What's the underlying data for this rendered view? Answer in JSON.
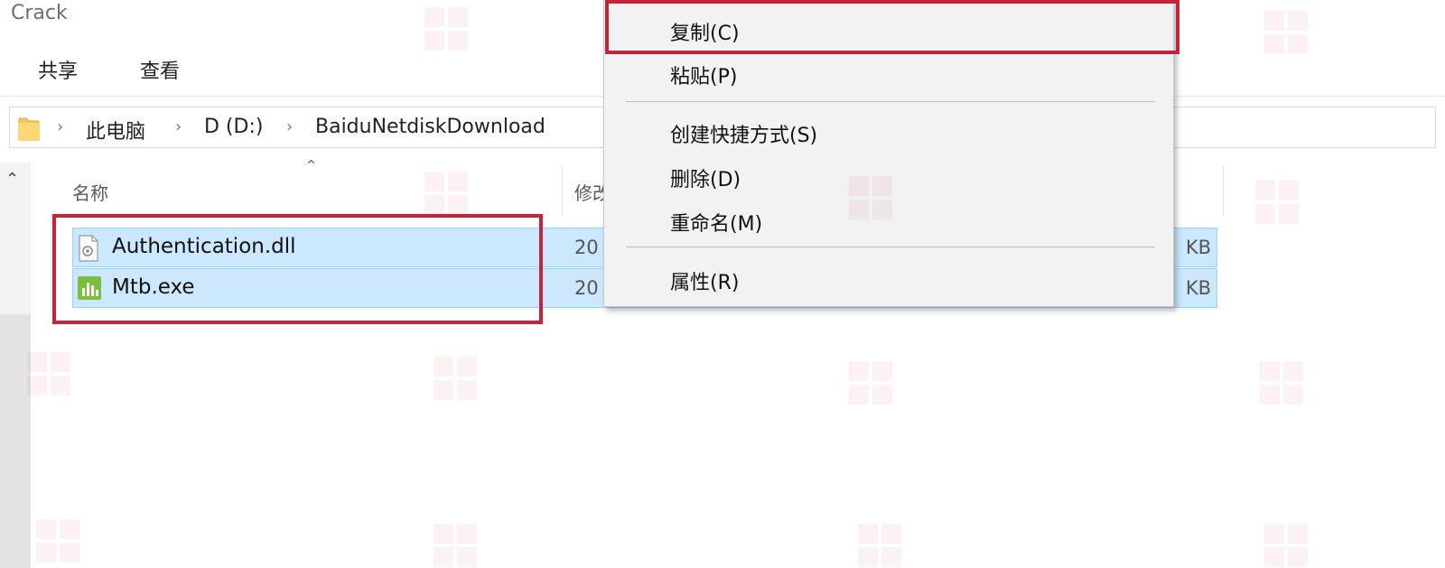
{
  "window": {
    "title": "Crack"
  },
  "ribbon": {
    "tabs": [
      "共享",
      "查看"
    ]
  },
  "address": {
    "crumbs": [
      "此电脑",
      "D (D:)",
      "BaiduNetdiskDownload"
    ]
  },
  "columns": {
    "name": "名称",
    "modified": "修改"
  },
  "files": [
    {
      "name": "Authentication.dll",
      "date": "20",
      "size": "KB",
      "icon": "dll-file-icon"
    },
    {
      "name": "Mtb.exe",
      "date": "20",
      "size": "KB",
      "icon": "exe-app-icon"
    }
  ],
  "context_menu": {
    "items": [
      {
        "label": "复制(C)"
      },
      {
        "label": "粘贴(P)"
      },
      {
        "label": "创建快捷方式(S)"
      },
      {
        "label": "删除(D)"
      },
      {
        "label": "重命名(M)"
      },
      {
        "label": "属性(R)"
      }
    ]
  },
  "colors": {
    "highlight_border": "#c4233a",
    "selection_bg": "#cce8ff",
    "menu_bg": "#f2f2f2"
  }
}
